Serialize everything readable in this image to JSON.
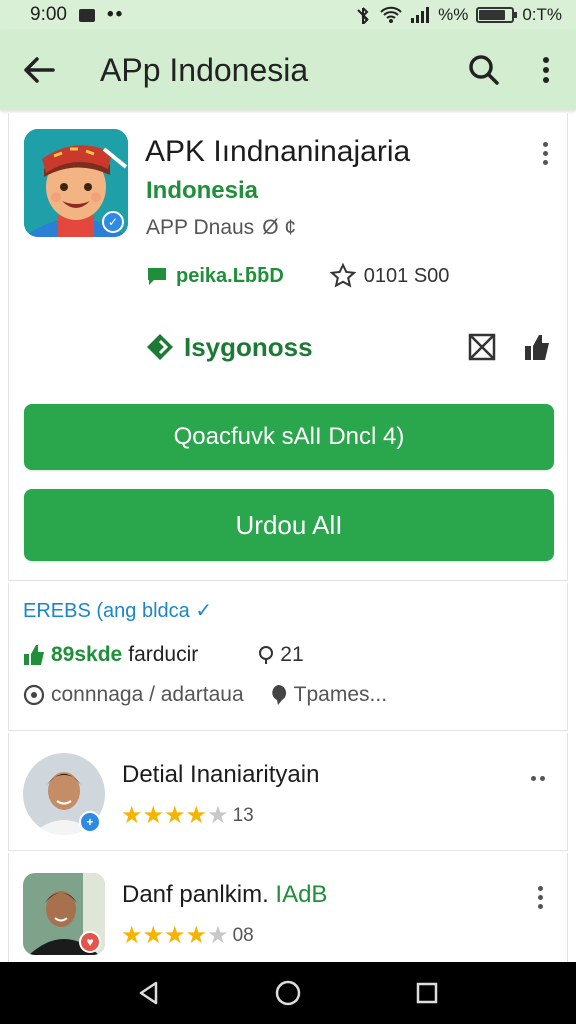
{
  "status_bar": {
    "time": "9:00",
    "dots": "••",
    "signal_text": "%%",
    "battery_text": "0:T%",
    "battery_level": 0.8
  },
  "app_bar": {
    "title": "APp Indonesia"
  },
  "app": {
    "name": "APK Iındnaninajaria",
    "developer": "Indonesia",
    "meta": "APP Dnaus",
    "meta_suffix": "Ø ¢",
    "stat_left": "peika.ĿƃƃD",
    "stat_right": "0101 S00",
    "tag": "Isygonoss"
  },
  "buttons": {
    "primary": "Qoacfuvk sAlI Dncl 4)",
    "secondary": "Urdou AlI"
  },
  "info": {
    "link": "EREBS (ang bldca ✓",
    "likes_value": "89skde",
    "likes_label": "farducir",
    "reviews": "21",
    "location": "connnaga / adartaua",
    "comments": "Tpames..."
  },
  "reviews": [
    {
      "name": "Detial Inaniarityain",
      "name_accent": "",
      "rating": 4,
      "count": "13"
    },
    {
      "name": "Danf panlkim.",
      "name_accent": "IAdB",
      "rating": 4,
      "count": "08"
    }
  ],
  "colors": {
    "accent": "#2aa64c",
    "app_bar": "#d3edd0",
    "star": "#f4b400",
    "link": "#1b86c9"
  },
  "icons": [
    "back-arrow-icon",
    "search-icon",
    "more-vert-icon",
    "verified-icon",
    "chat-icon",
    "star-outline-icon",
    "tag-icon",
    "cross-box-icon",
    "share-icon",
    "thumb-up-icon",
    "location-icon",
    "comment-icon",
    "nav-back-icon",
    "nav-home-icon",
    "nav-recents-icon"
  ]
}
